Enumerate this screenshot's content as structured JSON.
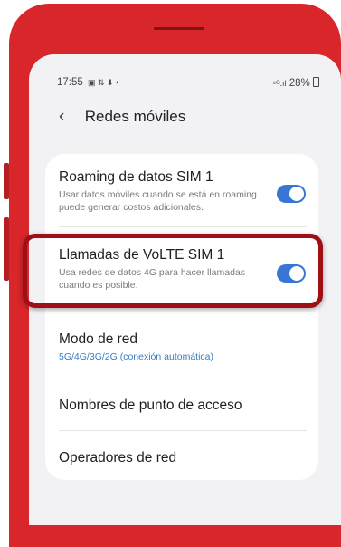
{
  "status_bar": {
    "time": "17:55",
    "left_icons": "▣ ⇅ ⬇ •",
    "right_icons": "⁴ᴳ.ıl",
    "battery": "28%"
  },
  "header": {
    "title": "Redes móviles"
  },
  "settings": [
    {
      "title": "Roaming de datos SIM 1",
      "subtitle": "Usar datos móviles cuando se está en roaming puede generar costos adicionales.",
      "toggle": true
    },
    {
      "title": "Llamadas de VoLTE SIM 1",
      "subtitle": "Usa redes de datos 4G para hacer llamadas cuando es posible.",
      "toggle": true
    },
    {
      "title": "Modo de red",
      "subtitle": "5G/4G/3G/2G (conexión automática)"
    },
    {
      "title": "Nombres de punto de acceso"
    },
    {
      "title": "Operadores de red"
    }
  ],
  "colors": {
    "phone_red": "#d8262a",
    "toggle_blue": "#3876d6",
    "highlight": "#9e1015",
    "link_blue": "#3a7cc2"
  }
}
